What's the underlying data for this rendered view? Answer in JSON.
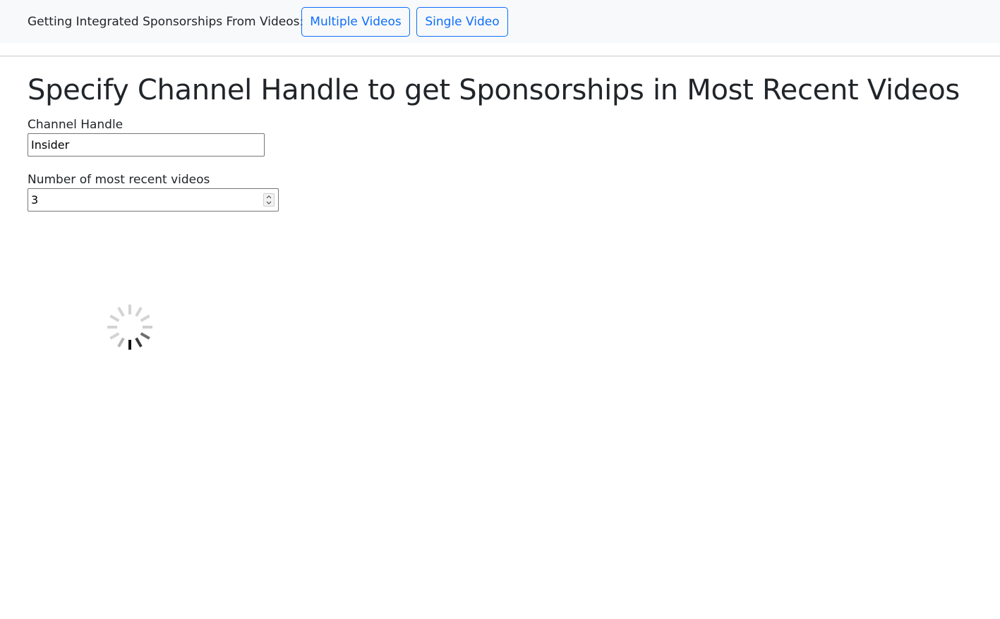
{
  "header": {
    "label": "Getting Integrated Sponsorships From Videos:",
    "buttons": {
      "multiple": "Multiple Videos",
      "single": "Single Video"
    }
  },
  "main": {
    "title": "Specify Channel Handle to get Sponsorships in Most Recent Videos",
    "channel_handle": {
      "label": "Channel Handle",
      "value": "Insider"
    },
    "video_count": {
      "label": "Number of most recent videos",
      "value": "3"
    }
  },
  "status": {
    "loading_icon": "spinner-icon"
  },
  "colors": {
    "accent": "#0d6efd",
    "header_bg": "#f8f9fa",
    "text": "#212529"
  }
}
